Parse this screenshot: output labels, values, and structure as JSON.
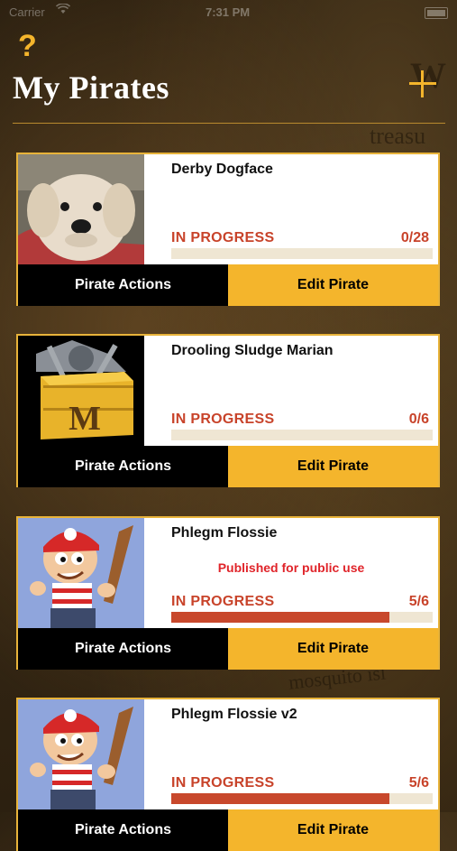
{
  "status_bar": {
    "carrier": "Carrier",
    "time": "7:31 PM"
  },
  "header": {
    "title": "My Pirates",
    "help_icon": "question-mark-icon",
    "add_icon": "plus-icon"
  },
  "colors": {
    "accent": "#f4b52c",
    "progress": "#c8482c",
    "published": "#e0242a"
  },
  "pirates": [
    {
      "name": "Derby Dogface",
      "published_note": "",
      "status": "IN PROGRESS",
      "count": "0/28",
      "progress": 0.0,
      "actions_label": "Pirate Actions",
      "edit_label": "Edit Pirate",
      "image": "dog-photo"
    },
    {
      "name": "Drooling Sludge Marian",
      "published_note": "",
      "status": "IN PROGRESS",
      "count": "0/6",
      "progress": 0.0,
      "actions_label": "Pirate Actions",
      "edit_label": "Edit Pirate",
      "image": "toolbox-m-logo"
    },
    {
      "name": "Phlegm Flossie",
      "published_note": "Published for public use",
      "status": "IN PROGRESS",
      "count": "5/6",
      "progress": 0.8333,
      "actions_label": "Pirate Actions",
      "edit_label": "Edit Pirate",
      "image": "cartoon-pirate-boy"
    },
    {
      "name": "Phlegm Flossie v2",
      "published_note": "",
      "status": "IN PROGRESS",
      "count": "5/6",
      "progress": 0.8333,
      "actions_label": "Pirate Actions",
      "edit_label": "Edit Pirate",
      "image": "cartoon-pirate-boy"
    }
  ]
}
